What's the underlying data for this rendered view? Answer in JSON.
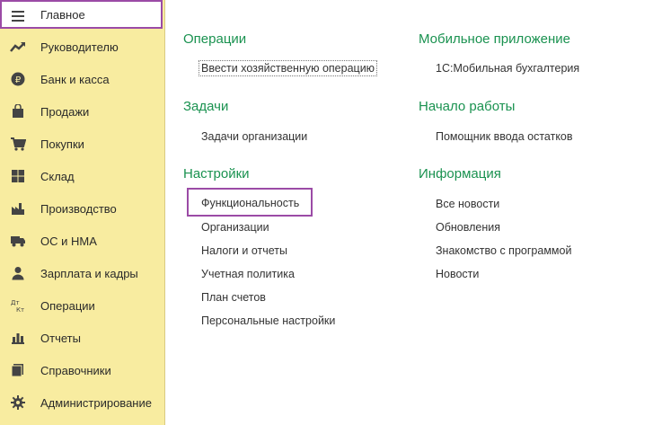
{
  "sidebar": {
    "items": [
      {
        "label": "Главное",
        "icon": "menu-icon"
      },
      {
        "label": "Руководителю",
        "icon": "trend-icon"
      },
      {
        "label": "Банк и касса",
        "icon": "ruble-icon"
      },
      {
        "label": "Продажи",
        "icon": "bag-icon"
      },
      {
        "label": "Покупки",
        "icon": "cart-icon"
      },
      {
        "label": "Склад",
        "icon": "warehouse-icon"
      },
      {
        "label": "Производство",
        "icon": "factory-icon"
      },
      {
        "label": "ОС и НМА",
        "icon": "truck-icon"
      },
      {
        "label": "Зарплата и кадры",
        "icon": "person-icon"
      },
      {
        "label": "Операции",
        "icon": "dt-kt-icon"
      },
      {
        "label": "Отчеты",
        "icon": "bar-chart-icon"
      },
      {
        "label": "Справочники",
        "icon": "books-icon"
      },
      {
        "label": "Администрирование",
        "icon": "gear-icon"
      }
    ]
  },
  "main": {
    "operations": {
      "title": "Операции",
      "links": [
        "Ввести хозяйственную операцию"
      ]
    },
    "tasks": {
      "title": "Задачи",
      "links": [
        "Задачи организации"
      ]
    },
    "settings": {
      "title": "Настройки",
      "links": [
        "Функциональность",
        "Организации",
        "Налоги и отчеты",
        "Учетная политика",
        "План счетов",
        "Персональные настройки"
      ]
    },
    "mobile": {
      "title": "Мобильное приложение",
      "links": [
        "1С:Мобильная бухгалтерия"
      ]
    },
    "start": {
      "title": "Начало работы",
      "links": [
        "Помощник ввода остатков"
      ]
    },
    "info": {
      "title": "Информация",
      "links": [
        "Все новости",
        "Обновления",
        "Знакомство с программой",
        "Новости"
      ]
    }
  },
  "colors": {
    "sidebar_bg": "#f8eca0",
    "section_title": "#1a9250",
    "highlight": "#9b4ba6"
  }
}
